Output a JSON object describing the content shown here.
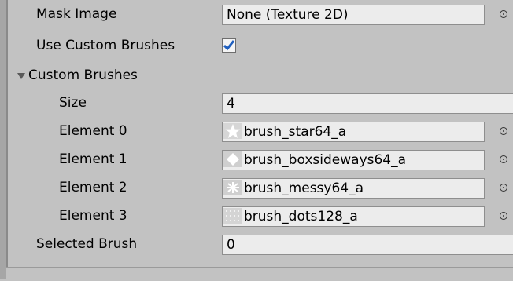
{
  "inspector": {
    "mask_image": {
      "label": "Mask Image",
      "value": "None (Texture 2D)"
    },
    "use_custom_brushes": {
      "label": "Use Custom Brushes",
      "checked": true
    },
    "custom_brushes": {
      "label": "Custom Brushes",
      "size": {
        "label": "Size",
        "value": "4"
      },
      "elements": [
        {
          "label": "Element 0",
          "value": "brush_star64_a",
          "icon": "star-thumbnail-icon"
        },
        {
          "label": "Element 1",
          "value": "brush_boxsideways64_a",
          "icon": "diamond-thumbnail-icon"
        },
        {
          "label": "Element 2",
          "value": "brush_messy64_a",
          "icon": "messy-thumbnail-icon"
        },
        {
          "label": "Element 3",
          "value": "brush_dots128_a",
          "icon": "dots-thumbnail-icon"
        }
      ]
    },
    "selected_brush": {
      "label": "Selected Brush",
      "value": "0"
    }
  },
  "colors": {
    "panel_background": "#c2c2c2",
    "field_background": "#ececec",
    "checkmark": "#1f5fbf"
  }
}
